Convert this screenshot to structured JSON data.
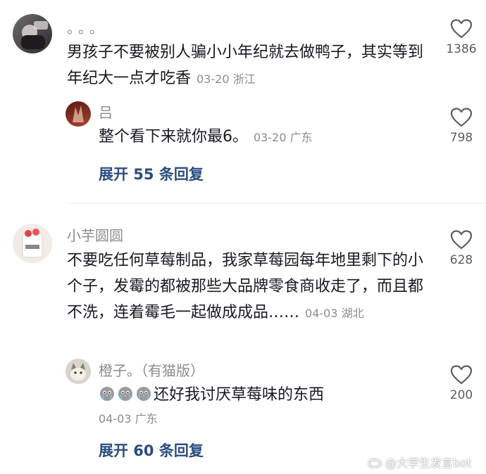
{
  "comments": [
    {
      "author": "。。。",
      "text": "男孩子不要被别人骗小小年纪就去做鸭子，其实等到年纪大一点才吃香",
      "meta": "03-20 浙江",
      "likes": "1386",
      "reply": {
        "author": "吕",
        "text": "整个看下来就你最6。",
        "meta": "03-20 广东",
        "likes": "798"
      },
      "expand_label": "展开 55 条回复"
    },
    {
      "author": "小芋圆圆",
      "text": "不要吃任何草莓制品，我家草莓园每年地里剩下的小个子，发霉的都被那些大品牌零食商收走了，而且都不洗，连着霉毛一起做成成品……",
      "meta": "04-03 湖北",
      "likes": "628",
      "reply": {
        "author": "橙子。（有猫版）",
        "text": "还好我讨厌草莓味的东西",
        "meta": "04-03 广东",
        "likes": "200",
        "emojis": [
          "crying-chick-icon",
          "crying-chick-icon",
          "crying-chick-icon"
        ]
      },
      "expand_label": "展开 60 条回复"
    }
  ],
  "watermark": "@大学生发言bot",
  "icons": {
    "like": "heart-outline-icon",
    "watermark": "weibo-logo-icon"
  },
  "colors": {
    "text": "#161823",
    "secondary": "#8a8b91",
    "link": "#2b4c7e"
  }
}
